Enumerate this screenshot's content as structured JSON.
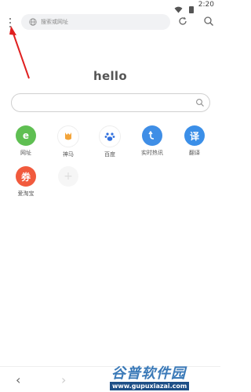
{
  "status": {
    "time": "2:20",
    "icons": [
      "wifi-icon",
      "battery-icon"
    ]
  },
  "toolbar": {
    "url_placeholder": "搜索或网址"
  },
  "page": {
    "title": "hello"
  },
  "shortcuts": [
    {
      "label": "网址",
      "icon_text": "e",
      "color": "#5fbf52"
    },
    {
      "label": "神马",
      "icon_text": "🐴",
      "color": "#ffffff"
    },
    {
      "label": "百度",
      "icon_text": "🐾",
      "color": "#ffffff"
    },
    {
      "label": "实时热讯",
      "icon_text": "↰",
      "color": "#3f8ee6"
    },
    {
      "label": "翻译",
      "icon_text": "译",
      "color": "#3b8fe8"
    },
    {
      "label": "爱淘宝",
      "icon_text": "券",
      "color": "#f15a3d"
    },
    {
      "label": "",
      "icon_text": "+",
      "color": "#f4f4f4"
    }
  ],
  "watermark": {
    "title": "谷普软件园",
    "url": "www.gupuxiazai.com"
  }
}
